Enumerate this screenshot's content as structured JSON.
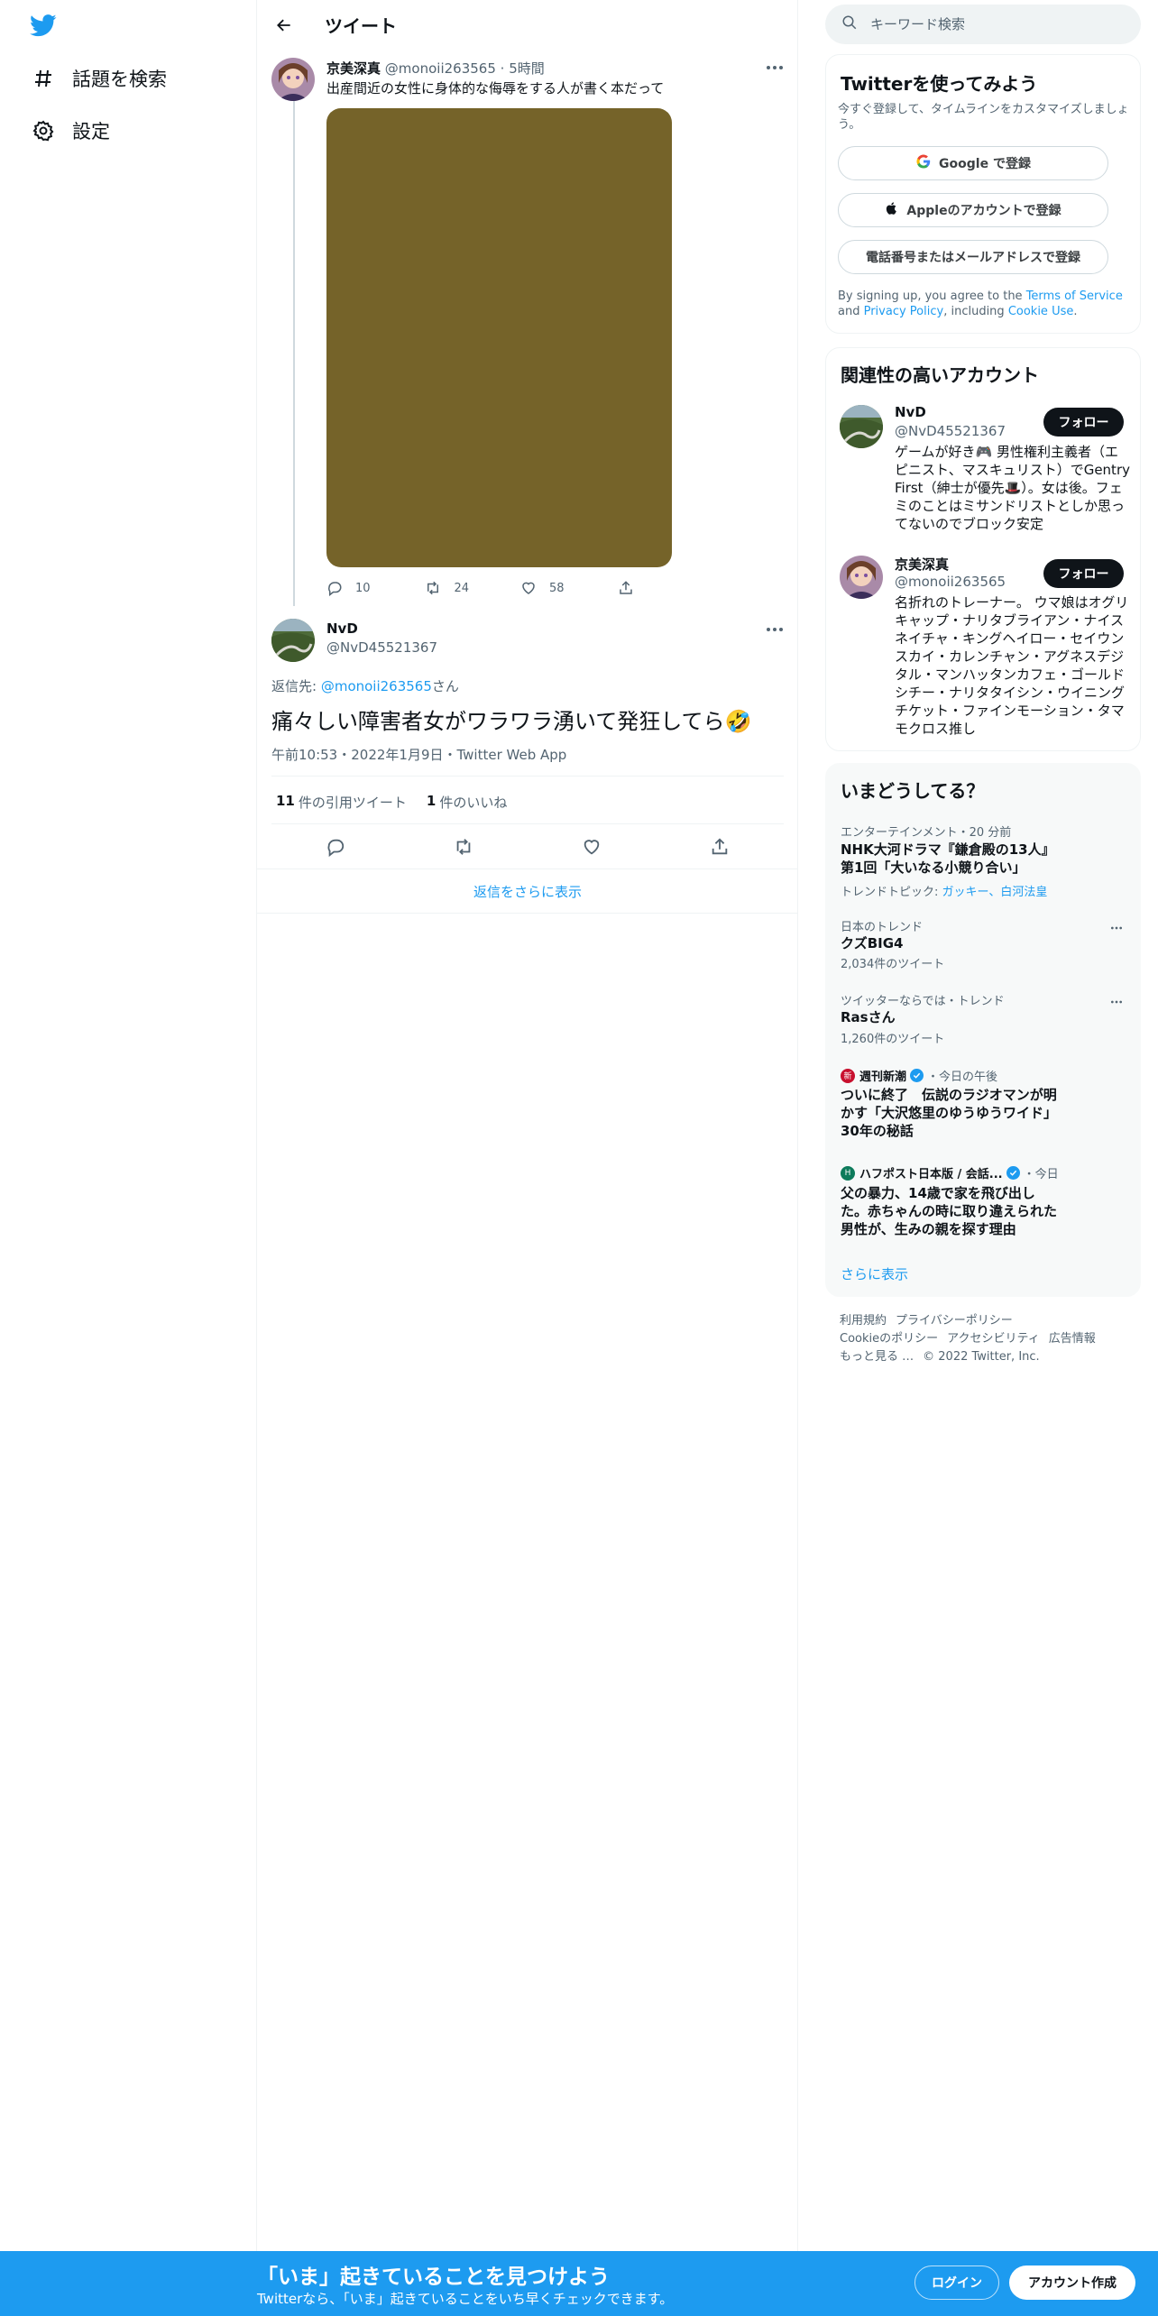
{
  "nav": {
    "items": [
      {
        "label": "話題を検索",
        "icon": "hashtag-icon"
      },
      {
        "label": "設定",
        "icon": "gear-icon"
      }
    ]
  },
  "header": {
    "title": "ツイート"
  },
  "parent_tweet": {
    "author_name": "京美深真",
    "handle": "@monoii263565",
    "time": "5時間",
    "text": "出産間近の女性に身体的な侮辱をする人が書く本だって",
    "replies": "10",
    "retweets": "24",
    "likes": "58",
    "media_color": "#756329"
  },
  "main_tweet": {
    "author_name": "NvD",
    "handle": "@NvD45521367",
    "reply_to_prefix": "返信先: ",
    "reply_to_handle": "@monoii263565",
    "reply_to_suffix": "さん",
    "text": "痛々しい障害者女がワラワラ湧いて発狂してら🤣",
    "timestamp": "午前10:53・2022年1月9日・Twitter Web App",
    "quote_count": "11",
    "quote_label": "件の引用ツイート",
    "like_count": "1",
    "like_label": "件のいいね"
  },
  "show_more_replies": "返信をさらに表示",
  "search": {
    "placeholder": "キーワード検索"
  },
  "signup_card": {
    "title": "Twitterを使ってみよう",
    "subtitle": "今すぐ登録して、タイムラインをカスタマイズしましょう。",
    "google": "Google で登録",
    "apple": "Appleのアカウントで登録",
    "phone": "電話番号またはメールアドレスで登録",
    "legal_1": "By signing up, you agree to the ",
    "terms": "Terms of Service",
    "legal_2": " and ",
    "privacy": "Privacy Policy",
    "legal_3": ", including ",
    "cookie": "Cookie Use",
    "legal_4": "."
  },
  "related": {
    "title": "関連性の高いアカウント",
    "follow_label": "フォロー",
    "accounts": [
      {
        "name": "NvD",
        "handle": "@NvD45521367",
        "bio": "ゲームが好き🎮 男性権利主義者（エピニスト、マスキュリスト）でGentry First（紳士が優先🎩）。女は後。フェミのことはミサンドリストとしか思ってないのでブロック安定"
      },
      {
        "name": "京美深真",
        "handle": "@monoii263565",
        "bio": "名折れのトレーナー。 ウマ娘はオグリキャップ・ナリタブライアン・ナイスネイチャ・キングヘイロー・セイウンスカイ・カレンチャン・アグネスデジタル・マンハッタンカフェ・ゴールドシチー・ナリタタイシン・ウイニングチケット・ファインモーション・タマモクロス推し"
      }
    ]
  },
  "trends": {
    "title": "いまどうしてる？",
    "items": [
      {
        "category": "エンターテインメント・20 分前",
        "title": "NHK大河ドラマ『鎌倉殿の13人』第1回「大いなる小競り合い」",
        "topics_prefix": "トレンドトピック: ",
        "topics": "ガッキー、白河法皇"
      },
      {
        "category": "日本のトレンド",
        "title": "クズBIG4",
        "count": "2,034件のツイート"
      },
      {
        "category": "ツイッターならでは・トレンド",
        "title": "Rasさん",
        "count": "1,260件のツイート"
      }
    ],
    "news": [
      {
        "source": "週刊新潮",
        "time": "・今日の午後",
        "logo_text": "新",
        "logo_color": "#c8102e",
        "title": "ついに終了　伝説のラジオマンが明かす「大沢悠里のゆうゆうワイド」30年の秘話"
      },
      {
        "source": "ハフポスト日本版 / 会話...",
        "time": "・今日",
        "logo_text": "H",
        "logo_color": "#0d7b5b",
        "title": "父の暴力、14歳で家を飛び出した。赤ちゃんの時に取り違えられた男性が、生みの親を探す理由"
      }
    ],
    "show_more": "さらに表示"
  },
  "footer": {
    "links": [
      "利用規約",
      "プライバシーポリシー",
      "Cookieのポリシー",
      "アクセシビリティ",
      "広告情報",
      "もっと見る …"
    ],
    "copyright": "© 2022 Twitter, Inc."
  },
  "banner": {
    "title": "「いま」起きていることを見つけよう",
    "subtitle": "Twitterなら、「いま」起きていることをいち早くチェックできます。",
    "login": "ログイン",
    "signup": "アカウント作成"
  },
  "colors": {
    "accent": "#1d9bf0",
    "text": "#0f1419",
    "secondary_text": "#536471"
  }
}
